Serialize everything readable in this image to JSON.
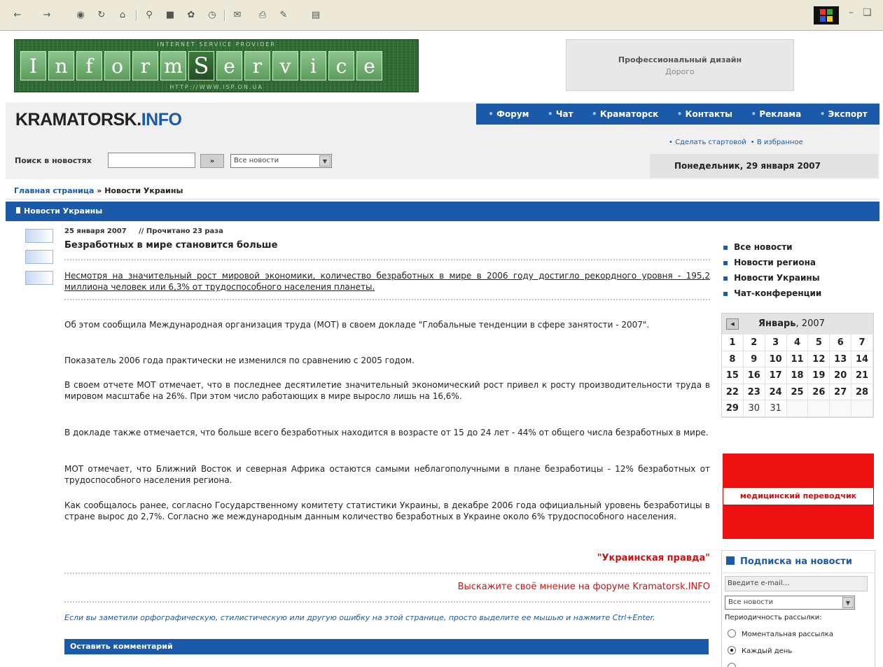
{
  "site": {
    "logo_main": "KRAMATORSK.",
    "logo_accent": "INFO"
  },
  "banner": {
    "letters": [
      "I",
      "n",
      "f",
      "o",
      "r",
      "m",
      "S",
      "e",
      "r",
      "v",
      "i",
      "c",
      "e"
    ],
    "top_text": "INTERNET SERVICE PROVIDER",
    "bottom_text": "HTTP://WWW.ISP.ON.UA"
  },
  "ad": {
    "title": "Профессиональный дизайн",
    "subtitle": "Дорого"
  },
  "nav": {
    "items": [
      "Форум",
      "Чат",
      "Краматорск",
      "Контакты",
      "Реклама",
      "Экспорт"
    ]
  },
  "quicklinks": [
    "• Сделать стартовой",
    "• В избранное"
  ],
  "date": "Понедельник, 29 января 2007",
  "search": {
    "label": "Поиск в новостях",
    "go_label": "»",
    "select_value": "Все новости"
  },
  "breadcrumb": {
    "home": "Главная страница",
    "separator": " » ",
    "current": "Новости Украины"
  },
  "section_title": "Новости Украины",
  "article": {
    "date": "25 января 2007",
    "reads": "// Прочитано 23 раза",
    "title": "Безработных в мире становится больше",
    "lead": "Несмотря на значительный рост мировой экономики, количество безработных в мире в 2006 году достигло рекордного уровня - 195,2 миллиона человек или 6,3% от трудоспособного населения планеты.",
    "paragraphs": [
      "Об этом сообщила Международная организация труда (МОТ) в своем докладе \"Глобальные тенденции в сфере занятости - 2007\".",
      "Показатель 2006 года практически не изменился по сравнению с 2005 годом.",
      "В своем отчете МОТ отмечает, что в последнее десятилетие значительный экономический рост привел к росту производительности труда в мировом масштабе на 26%. При этом число работающих в мире выросло лишь на 16,6%.",
      "В докладе также отмечается, что больше всего безработных находится в возрасте от 15 до 24 лет - 44% от общего числа безработных в мире.",
      "МОТ отмечает, что Ближний Восток и северная Африка остаются самыми неблагополучными в плане безработицы - 12% безработных от трудоспособного населения региона.",
      "Как сообщалось ранее, согласно Государственному комитету статистики Украины, в декабре 2006 года официальный уровень безработицы в стране вырос до 2,7%. Согласно же международным данным количество безработных в Украине около 6% трудоспособного населения."
    ],
    "source": "\"Украинская правда\"",
    "forum_link": "Выскажите своё мнение на форуме Kramatorsk.INFO",
    "typo_note": "Если вы заметили орфографическую, стилистическую или другую ошибку на этой странице, просто выделите ее мышью и нажмите Ctrl+Enter.",
    "comment_bar": "Оставить комментарий"
  },
  "sidebar": {
    "links": [
      "Все новости",
      "Новости региона",
      "Новости Украины",
      "Чат-конференции"
    ],
    "calendar": {
      "month": "Январь",
      "year": ", 2007",
      "days": [
        "1",
        "2",
        "3",
        "4",
        "5",
        "6",
        "7",
        "8",
        "9",
        "10",
        "11",
        "12",
        "13",
        "14",
        "15",
        "16",
        "17",
        "18",
        "19",
        "20",
        "21",
        "22",
        "23",
        "24",
        "25",
        "26",
        "27",
        "28",
        "29",
        "30",
        "31",
        "",
        "",
        "",
        ""
      ]
    },
    "red_ad_label": "медицинский переводчик",
    "subscribe": {
      "title": "Подписка на новости",
      "email_placeholder": "Введите e-mail...",
      "select_value": "Все новости",
      "period_label": "Периодичность рассылки:",
      "options": [
        "Моментальная рассылка",
        "Каждый день"
      ]
    }
  }
}
